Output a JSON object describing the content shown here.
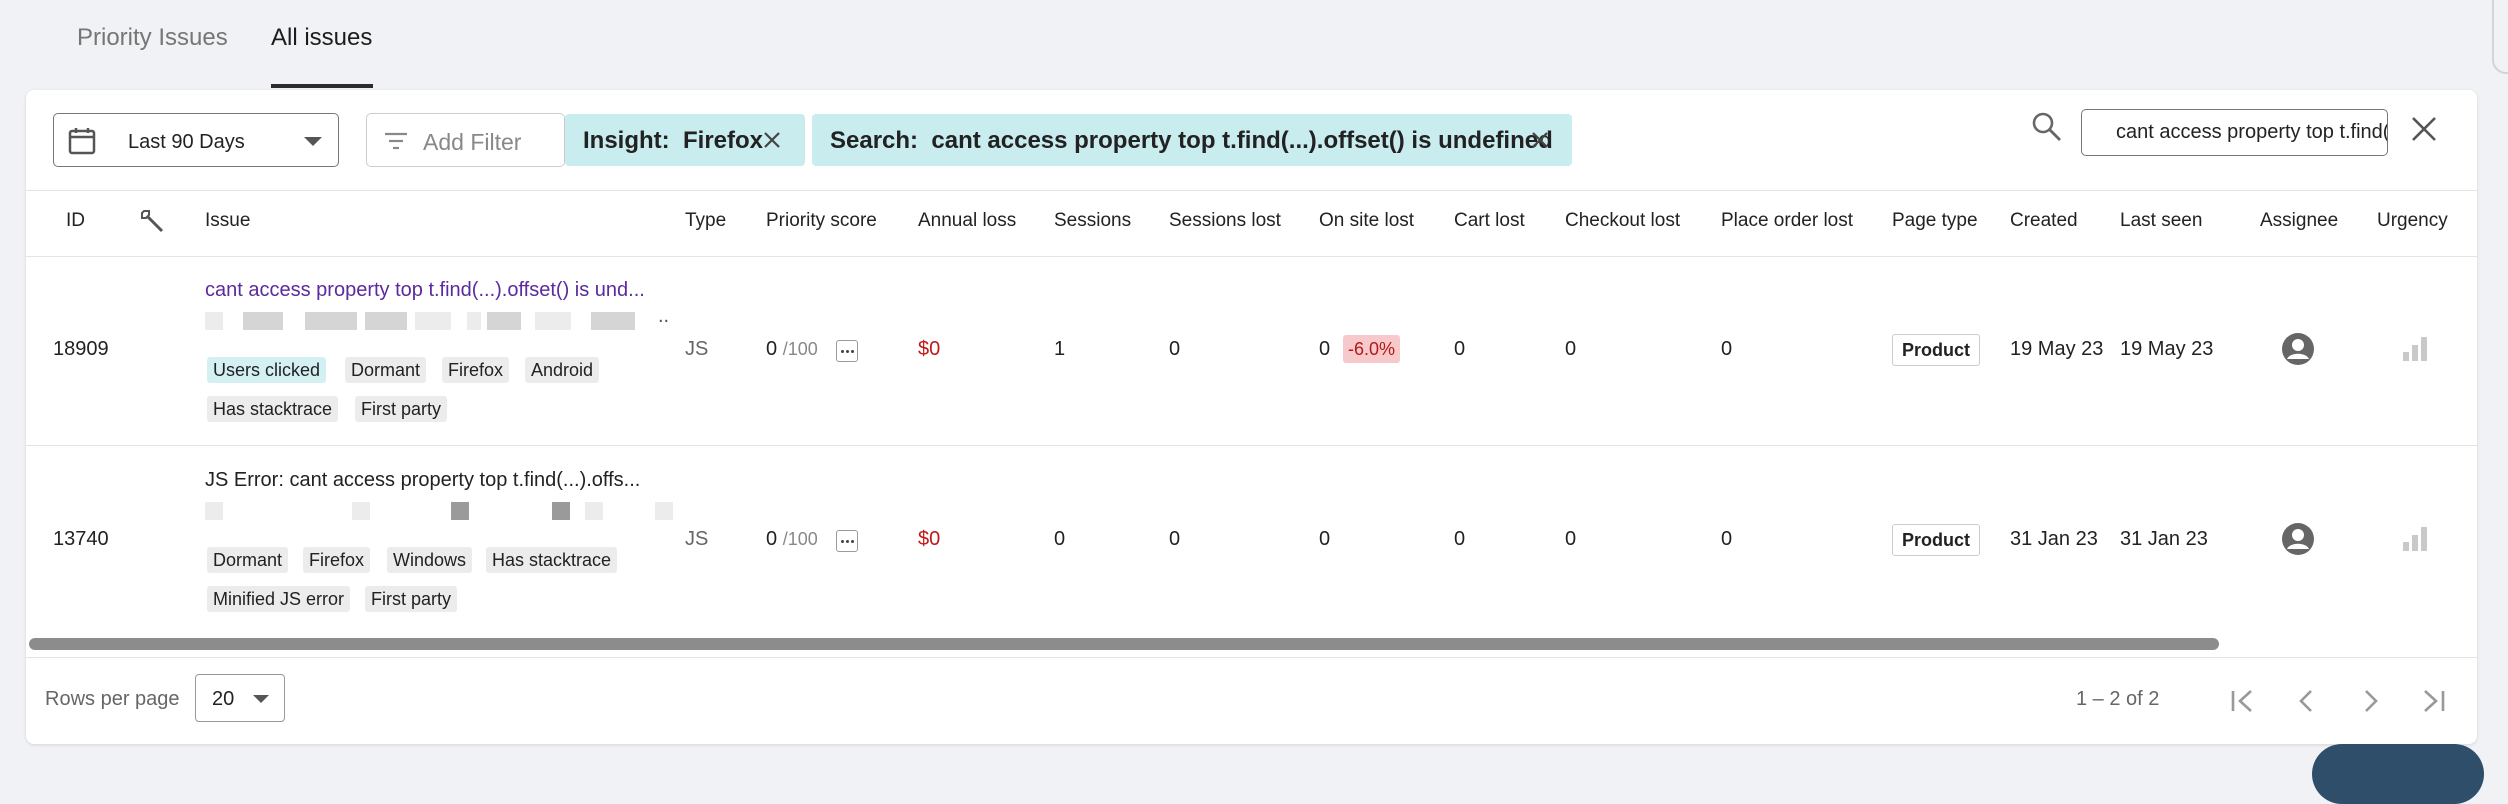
{
  "tabs": [
    {
      "label": "Priority Issues",
      "active": false
    },
    {
      "label": "All issues",
      "active": true
    }
  ],
  "filters": {
    "date_range": "Last 90 Days",
    "add_filter_label": "Add Filter",
    "chips": [
      {
        "label": "Insight:  Firefox"
      },
      {
        "label": "Search:  cant access property top t.find(...).offset() is undefined"
      }
    ],
    "search_value": "cant access property top t.find(...).offset() is undefined"
  },
  "table": {
    "columns": [
      "ID",
      "Issue",
      "Type",
      "Priority score",
      "Annual loss",
      "Sessions",
      "Sessions lost",
      "On site lost",
      "Cart lost",
      "Checkout lost",
      "Place order lost",
      "Page type",
      "Created",
      "Last seen",
      "Assignee",
      "Urgency"
    ],
    "rows": [
      {
        "id": "18909",
        "issue": "cant access property top t.find(...).offset() is und...",
        "trail": "..",
        "tags": [
          "Users clicked",
          "Dormant",
          "Firefox",
          "Android",
          "Has stacktrace",
          "First party"
        ],
        "type": "JS",
        "score": "0",
        "score_max": "/100",
        "annual_loss": "$0",
        "sessions": "1",
        "sessions_lost": "0",
        "on_site_lost": "0",
        "on_site_lost_pct": "-6.0%",
        "cart_lost": "0",
        "checkout_lost": "0",
        "place_order_lost": "0",
        "page_type": "Product",
        "created": "19 May 23",
        "last_seen": "19 May 23"
      },
      {
        "id": "13740",
        "issue": "JS Error: cant access property top t.find(...).offs...",
        "tags": [
          "Dormant",
          "Firefox",
          "Windows",
          "Has stacktrace",
          "Minified JS error",
          "First party"
        ],
        "type": "JS",
        "score": "0",
        "score_max": "/100",
        "annual_loss": "$0",
        "sessions": "0",
        "sessions_lost": "0",
        "on_site_lost": "0",
        "cart_lost": "0",
        "checkout_lost": "0",
        "place_order_lost": "0",
        "page_type": "Product",
        "created": "31 Jan 23",
        "last_seen": "31 Jan 23"
      }
    ]
  },
  "pagination": {
    "rows_per_page_label": "Rows per page",
    "rows_per_page": "20",
    "range": "1 – 2 of 2"
  },
  "colors": {
    "chip_bg": "#c9ecef",
    "link": "#5b2a9e",
    "loss_red": "#c01818",
    "badge_red_bg": "#f7c9cb"
  }
}
